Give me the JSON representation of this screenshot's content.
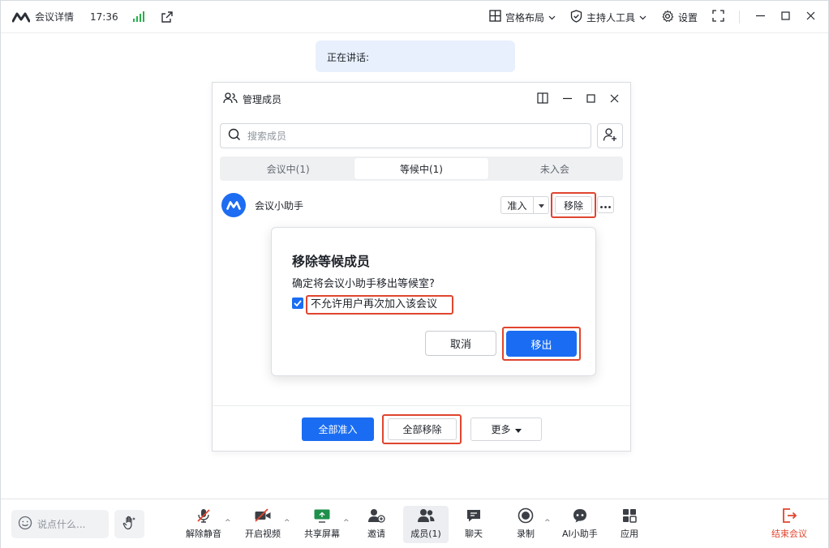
{
  "topbar": {
    "meeting_details": "会议详情",
    "time": "17:36",
    "grid_layout": "宫格布局",
    "host_tools": "主持人工具",
    "settings": "设置"
  },
  "speaking": {
    "label": "正在讲话:"
  },
  "panel": {
    "title": "管理成员",
    "search_placeholder": "搜索成员",
    "tabs": [
      {
        "label": "会议中(1)"
      },
      {
        "label": "等候中(1)"
      },
      {
        "label": "未入会"
      }
    ],
    "member": {
      "name": "会议小助手",
      "admit_label": "准入",
      "remove_label": "移除"
    },
    "footer": {
      "admit_all": "全部准入",
      "remove_all": "全部移除",
      "more": "更多"
    }
  },
  "dialog": {
    "title": "移除等候成员",
    "message": "确定将会议小助手移出等候室?",
    "checkbox_label": "不允许用户再次加入该会议",
    "cancel": "取消",
    "confirm": "移出"
  },
  "bottombar": {
    "chat_placeholder": "说点什么...",
    "tools": [
      {
        "label": "解除静音"
      },
      {
        "label": "开启视频"
      },
      {
        "label": "共享屏幕"
      },
      {
        "label": "邀请"
      },
      {
        "label": "成员(1)"
      },
      {
        "label": "聊天"
      },
      {
        "label": "录制"
      },
      {
        "label": "AI小助手"
      },
      {
        "label": "应用"
      }
    ],
    "end_meeting": "结束会议"
  },
  "colors": {
    "accent": "#1a6df3",
    "highlight": "#e0452f",
    "signal": "#27b04b",
    "speaking_bg": "#e8f0fd"
  }
}
